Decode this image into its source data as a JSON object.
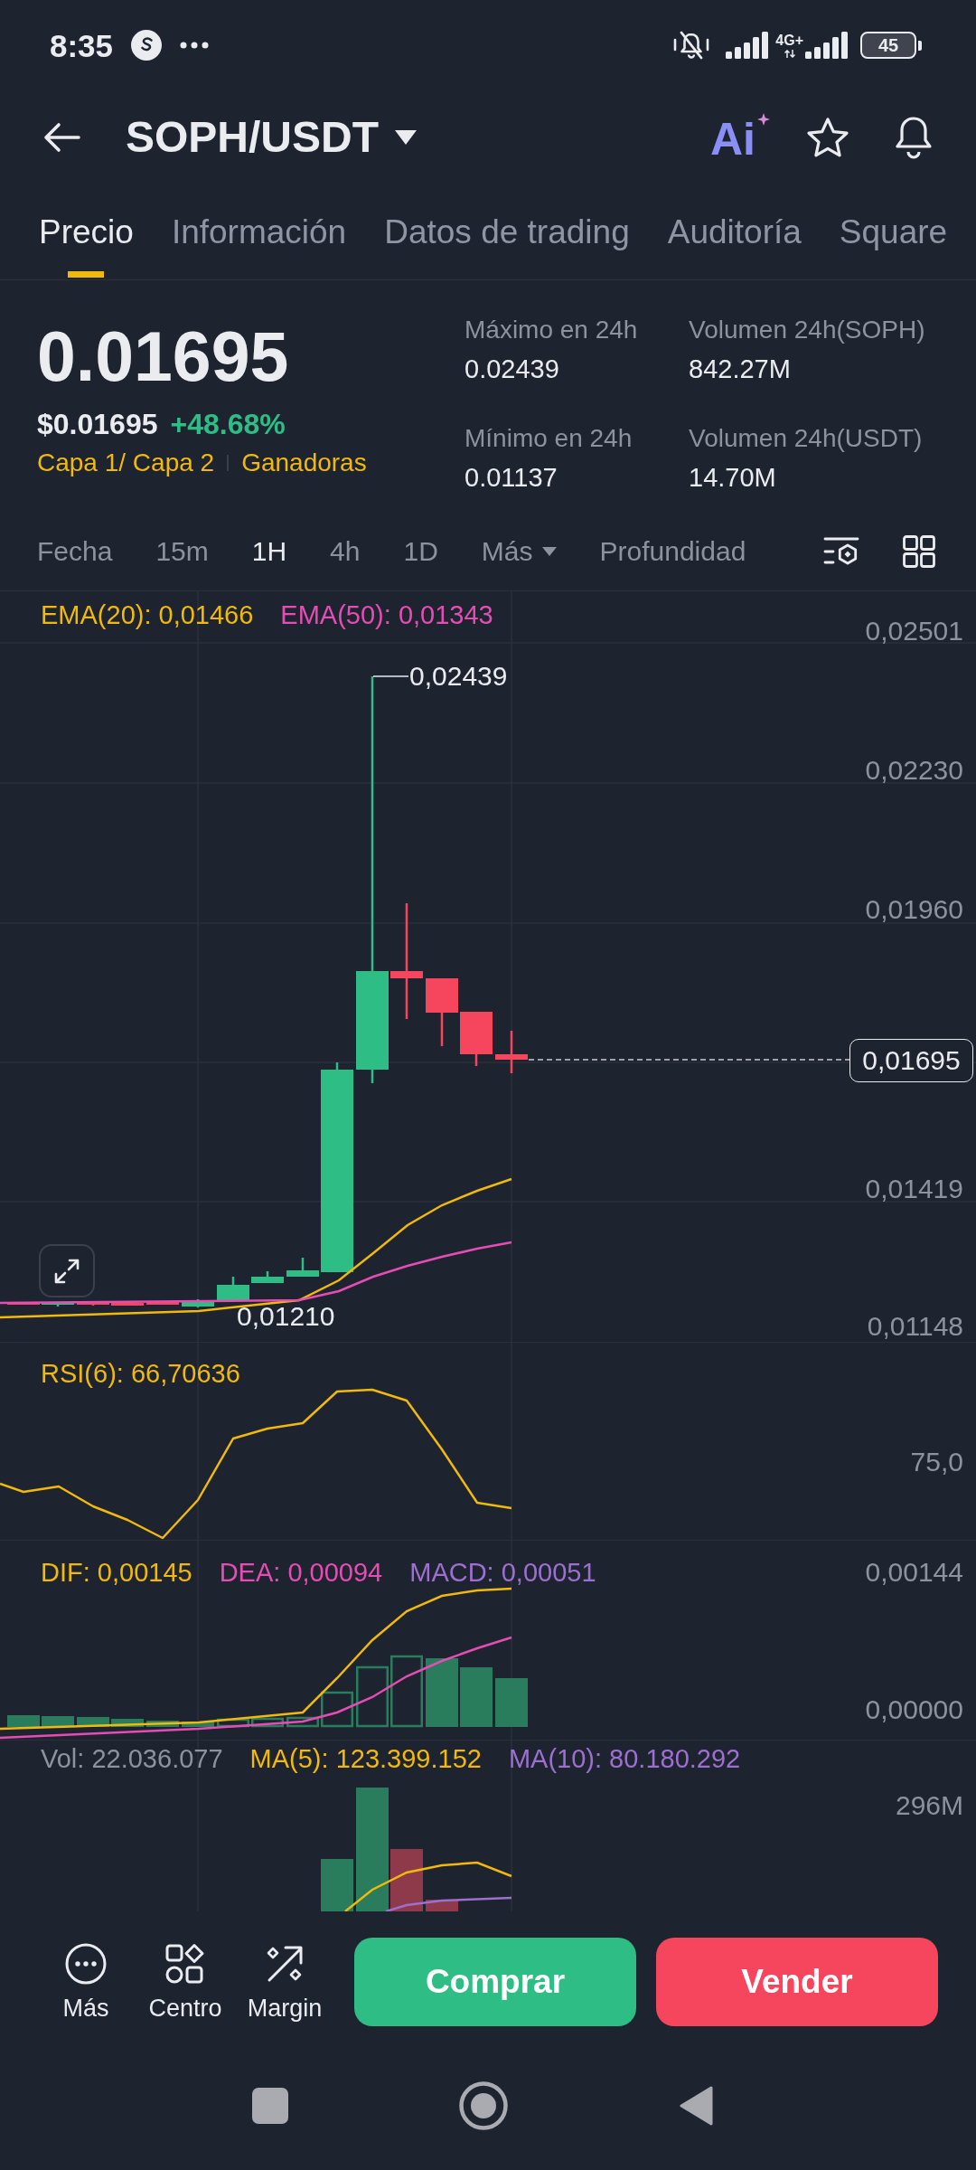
{
  "status_bar": {
    "time": "8:35",
    "network": "4G+",
    "battery": "45"
  },
  "header": {
    "title": "SOPH/USDT",
    "ai_label": "Ai"
  },
  "tabs": [
    {
      "label": "Precio",
      "selected": true
    },
    {
      "label": "Información",
      "selected": false
    },
    {
      "label": "Datos de trading",
      "selected": false
    },
    {
      "label": "Auditoría",
      "selected": false
    },
    {
      "label": "Square",
      "selected": false
    }
  ],
  "price": {
    "last": "0.01695",
    "fiat": "$0.01695",
    "change": "+48.68%",
    "tags": [
      "Capa 1/ Capa 2",
      "Ganadoras"
    ]
  },
  "stats": [
    {
      "label": "Máximo en 24h",
      "value": "0.02439"
    },
    {
      "label": "Volumen 24h(SOPH)",
      "value": "842.27M"
    },
    {
      "label": "Mínimo en 24h",
      "value": "0.01137"
    },
    {
      "label": "Volumen 24h(USDT)",
      "value": "14.70M"
    }
  ],
  "intervals": [
    {
      "label": "Fecha",
      "kind": "option",
      "selected": false
    },
    {
      "label": "15m",
      "kind": "option",
      "selected": false
    },
    {
      "label": "1H",
      "kind": "option",
      "selected": true
    },
    {
      "label": "4h",
      "kind": "option",
      "selected": false
    },
    {
      "label": "1D",
      "kind": "option",
      "selected": false
    },
    {
      "label": "Más",
      "kind": "dropdown",
      "selected": false
    },
    {
      "label": "Profundidad",
      "kind": "option",
      "selected": false
    }
  ],
  "main_chart": {
    "legend": [
      {
        "text": "EMA(20): 0,01466",
        "color": "#f0b90b"
      },
      {
        "text": "EMA(50): 0,01343",
        "color": "#e64db4"
      }
    ],
    "y_labels": [
      "0,02501",
      "0,02230",
      "0,01960",
      "0,01419",
      "0,01148"
    ],
    "high_label": "0,02439",
    "low_label": "0,01210",
    "last_price_label": "0,01695"
  },
  "rsi_chart": {
    "legend": [
      {
        "text": "RSI(6): 66,70636",
        "color": "#f0b90b"
      }
    ],
    "y_labels": [
      "75,0"
    ]
  },
  "macd_chart": {
    "legend": [
      {
        "text": "DIF: 0,00145",
        "color": "#f0b90b"
      },
      {
        "text": "DEA: 0,00094",
        "color": "#e64db4"
      },
      {
        "text": "MACD: 0,00051",
        "color": "#9c6fd0"
      }
    ],
    "y_labels": [
      "0,00144",
      "0,00000"
    ]
  },
  "volume_chart": {
    "legend": [
      {
        "text": "Vol: 22.036.077",
        "color": "#8d939e"
      },
      {
        "text": "MA(5): 123.399.152",
        "color": "#f0b90b"
      },
      {
        "text": "MA(10): 80.180.292",
        "color": "#9c6fd0"
      }
    ],
    "y_labels": [
      "296M"
    ]
  },
  "bottom_bar": {
    "actions": [
      {
        "label": "Más"
      },
      {
        "label": "Centro"
      },
      {
        "label": "Margin"
      }
    ],
    "buy_label": "Comprar",
    "sell_label": "Vender"
  }
}
